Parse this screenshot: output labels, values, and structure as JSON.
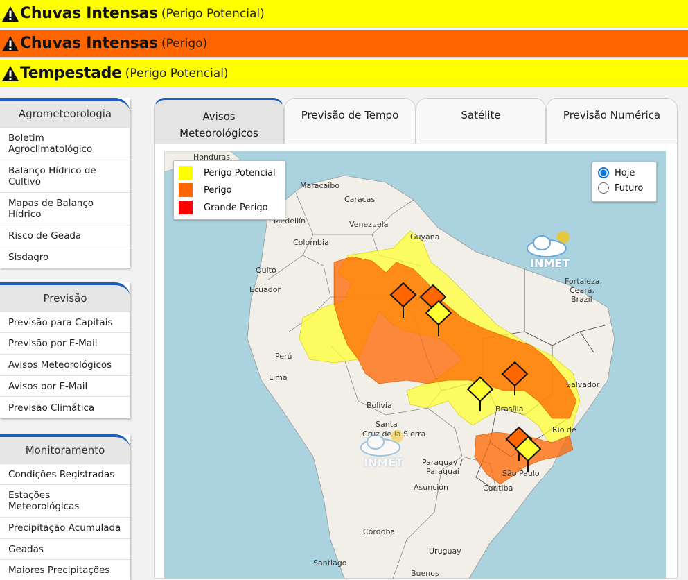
{
  "alerts": [
    {
      "title": "Chuvas Intensas",
      "level": "(Perigo Potencial)",
      "color": "#ffff00"
    },
    {
      "title": "Chuvas Intensas",
      "level": "(Perigo)",
      "color": "#ff6600"
    },
    {
      "title": "Tempestade",
      "level": "(Perigo Potencial)",
      "color": "#ffff00"
    }
  ],
  "menus": {
    "agro": {
      "title": "Agrometeorologia",
      "items": [
        "Boletim Agroclimatológico",
        "Balanço Hídrico de Cultivo",
        "Mapas de Balanço Hídrico",
        "Risco de Geada",
        "Sisdagro"
      ]
    },
    "previsao": {
      "title": "Previsão",
      "items": [
        "Previsão para Capitais",
        "Previsão por E-Mail",
        "Avisos Meteorológicos",
        "Avisos por E-Mail",
        "Previsão Climática"
      ]
    },
    "monitoramento": {
      "title": "Monitoramento",
      "items": [
        "Condições Registradas",
        "Estações Meteorológicas",
        "Precipitação Acumulada",
        "Geadas",
        "Maiores Precipitações"
      ]
    }
  },
  "tabs": [
    "Avisos Meteorológicos",
    "Previsão de Tempo",
    "Satélite",
    "Previsão Numérica"
  ],
  "legend": [
    {
      "label": "Perigo Potencial",
      "color": "#ffff00"
    },
    {
      "label": "Perigo",
      "color": "#ff6600"
    },
    {
      "label": "Grande Perigo",
      "color": "#ff0000"
    }
  ],
  "radio": {
    "options": [
      "Hoje",
      "Futuro"
    ],
    "selected": "Hoje"
  },
  "logo_text": "INMET",
  "map_labels": {
    "honduras": "Honduras",
    "maracaibo": "Maracaibo",
    "caracas": "Caracas",
    "medellin": "Medellín",
    "venezuela": "Venezuela",
    "colombia": "Colombia",
    "guyana": "Guyana",
    "quito": "Quito",
    "ecuador": "Ecuador",
    "fortaleza": "Fortaleza,",
    "ceara": "Ceará,",
    "brazil": "Brazil",
    "peru": "Perú",
    "lima": "Lima",
    "bolivia": "Bolivia",
    "salvador": "Salvador",
    "brasilia": "Brasília",
    "santa": "Santa",
    "cruz": "Cruz de la Sierra",
    "paraguay": "Paraguay /",
    "paraguai": "Paraguai",
    "asuncion": "Asunción",
    "curitiba": "Curitiba",
    "saopaulo": "São Paulo",
    "rio": "Rio de",
    "cordoba": "Córdoba",
    "uruguay": "Uruguay",
    "santiago": "Santiago",
    "buenos": "Buenos"
  }
}
